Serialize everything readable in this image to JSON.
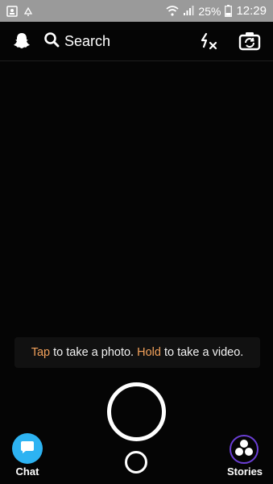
{
  "status_bar": {
    "battery": "25%",
    "time": "12:29",
    "icons": [
      "gallery-icon",
      "notification-icon",
      "wifi-icon",
      "signal-icon",
      "battery-icon"
    ]
  },
  "top_bar": {
    "search_label": "Search",
    "icons": [
      "ghost-icon",
      "search-icon",
      "flash-off-icon",
      "flip-camera-icon"
    ]
  },
  "hint": {
    "tap": "Tap",
    "tap_rest": " to take a photo. ",
    "hold": "Hold",
    "hold_rest": " to take a video."
  },
  "bottom": {
    "chat_label": "Chat",
    "stories_label": "Stories"
  },
  "colors": {
    "status_bar": "#9a9a9a",
    "background": "#050505",
    "accent_text": "#f2a15b",
    "chat_blue": "#2db3f2",
    "stories_ring": "#6b3fd6"
  }
}
